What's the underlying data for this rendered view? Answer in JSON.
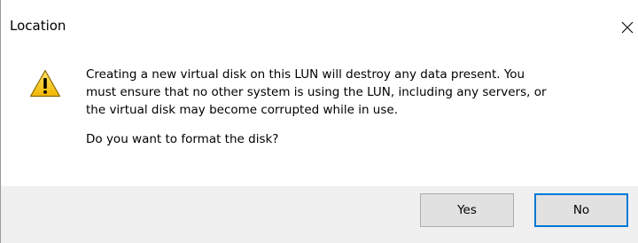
{
  "window": {
    "title": "Location",
    "close_icon": "close-icon"
  },
  "message": {
    "icon": "warning-icon",
    "icon_colors": {
      "fill": "#f9c400",
      "outline": "#7a5b00",
      "glyph": "#000000"
    },
    "line1": "Creating a new virtual disk on this LUN will destroy any data present. You",
    "line2": "must ensure that no other system is using the LUN, including any servers, or",
    "line3": "the virtual disk may become corrupted while in use.",
    "question": "Do you want to format the disk?"
  },
  "buttons": {
    "yes_label": "Yes",
    "no_label": "No",
    "default": "No",
    "accent": "#0078d7"
  }
}
